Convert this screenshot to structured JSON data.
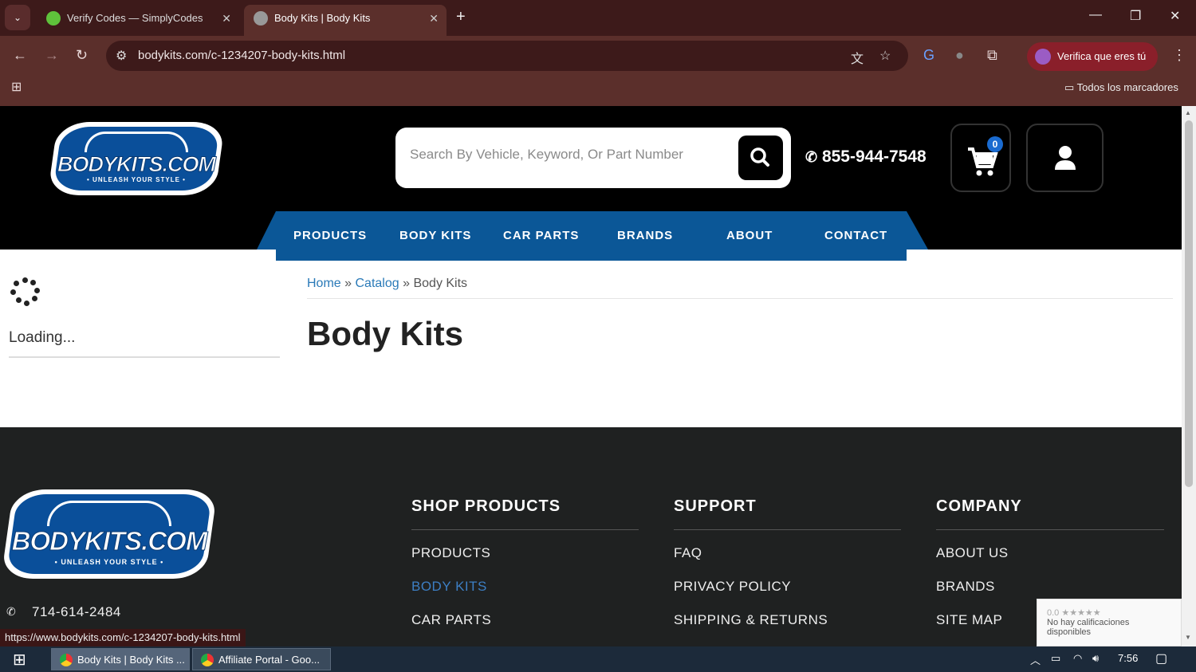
{
  "browser": {
    "tabs": [
      {
        "title": "Verify Codes — SimplyCodes",
        "active": false
      },
      {
        "title": "Body Kits | Body Kits",
        "active": true
      }
    ],
    "url": "bodykits.com/c-1234207-body-kits.html",
    "profile_button": "Verifica que eres tú",
    "bookmarks_label": "Todos los marcadores",
    "status_url": "https://www.bodykits.com/c-1234207-body-kits.html"
  },
  "header": {
    "logo_text": "BODYKITS.COM",
    "logo_tagline": "• UNLEASH YOUR STYLE •",
    "search_placeholder": "Search By Vehicle, Keyword, Or Part Number",
    "phone": "855-944-7548",
    "cart_count": "0"
  },
  "menu": [
    "PRODUCTS",
    "BODY KITS",
    "CAR PARTS",
    "BRANDS",
    "ABOUT",
    "CONTACT"
  ],
  "sidebar": {
    "loading_text": "Loading..."
  },
  "breadcrumb": {
    "home": "Home",
    "sep1": "»",
    "catalog": "Catalog",
    "sep2": "»",
    "current": "Body Kits"
  },
  "page_title": "Body Kits",
  "footer": {
    "phone": "714-614-2484",
    "columns": [
      {
        "title": "SHOP PRODUCTS",
        "links": [
          "PRODUCTS",
          "BODY KITS",
          "CAR PARTS"
        ]
      },
      {
        "title": "SUPPORT",
        "links": [
          "FAQ",
          "PRIVACY POLICY",
          "SHIPPING & RETURNS"
        ]
      },
      {
        "title": "COMPANY",
        "links": [
          "ABOUT US",
          "BRANDS",
          "SITE MAP"
        ]
      }
    ],
    "recaptcha_rating": "0.0 ★★★★★",
    "recaptcha_text": "No hay calificaciones disponibles"
  },
  "taskbar": {
    "items": [
      "Body Kits | Body Kits ...",
      "Affiliate Portal - Goo..."
    ],
    "time": "7:56"
  },
  "colors": {
    "brand_blue": "#0b5797",
    "link_blue": "#2a7ab8",
    "active_link": "#3d7fc4"
  }
}
